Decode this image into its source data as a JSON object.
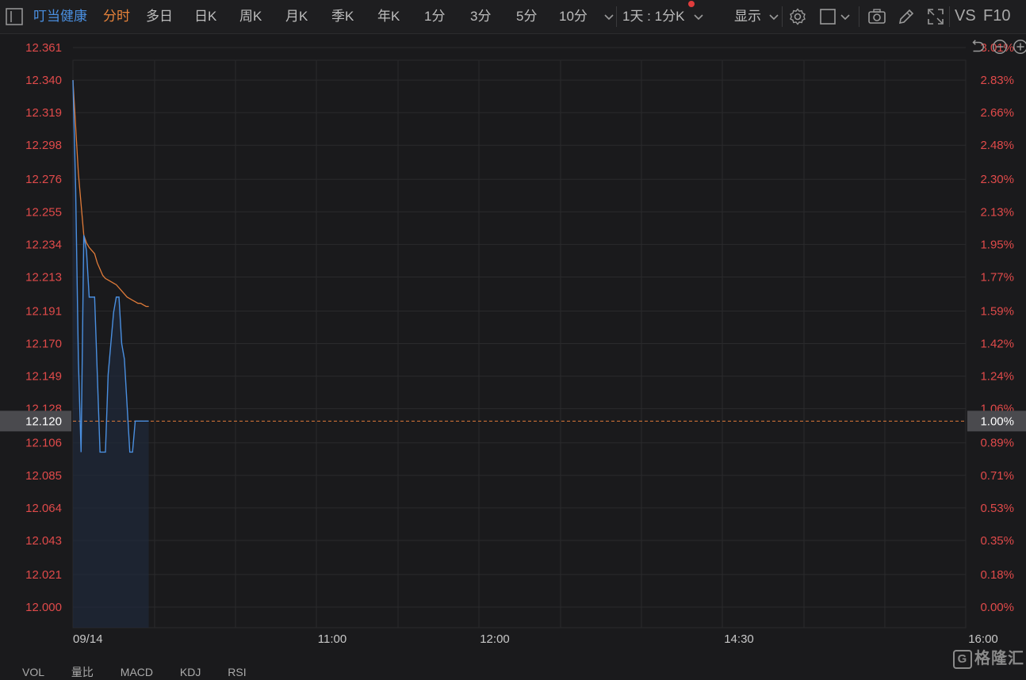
{
  "toolbar": {
    "stock_name": "叮当健康",
    "tabs": [
      "分时",
      "多日",
      "日K",
      "周K",
      "月K",
      "季K",
      "年K",
      "1分",
      "3分",
      "5分",
      "10分"
    ],
    "active_tab": "分时",
    "period_select": "1天 : 1分K",
    "display_label": "显示",
    "vs_label": "VS",
    "f10_label": "F10",
    "icons": [
      "sidebar-toggle-icon",
      "chevron-down-icon",
      "gear-icon",
      "checkbox-icon",
      "camera-icon",
      "pencil-icon",
      "fullscreen-icon",
      "reset-icon",
      "zoom-out-icon",
      "zoom-in-icon"
    ]
  },
  "colors": {
    "background": "#1a1a1c",
    "grid": "#2a2a2c",
    "axis_text": "#e04a4a",
    "price_line": "#4a8fe0",
    "avg_line": "#e07b39",
    "ref_line": "#e07b39",
    "ref_label_bg": "#4a4a4e"
  },
  "chart_data": {
    "type": "line",
    "x_ticks": [
      "09/14",
      "11:00",
      "12:00",
      "14:30",
      "16:00"
    ],
    "y_ticks_left": [
      "12.361",
      "12.340",
      "12.319",
      "12.298",
      "12.276",
      "12.255",
      "12.234",
      "12.213",
      "12.191",
      "12.170",
      "12.149",
      "12.128",
      "12.106",
      "12.085",
      "12.064",
      "12.043",
      "12.021",
      "12.000"
    ],
    "y_ticks_right": [
      "3.01%",
      "2.83%",
      "2.66%",
      "2.48%",
      "2.30%",
      "2.13%",
      "1.95%",
      "1.77%",
      "1.59%",
      "1.42%",
      "1.24%",
      "1.06%",
      "0.89%",
      "0.71%",
      "0.53%",
      "0.35%",
      "0.18%",
      "0.00%"
    ],
    "ylim": [
      12.0,
      12.361
    ],
    "reference_price": 12.12,
    "reference_price_label": "12.120",
    "reference_pct_label": "1.00%",
    "session_minutes": 330,
    "series": [
      {
        "type": "price",
        "x": [
          0,
          1,
          2,
          3,
          4,
          5,
          6,
          7,
          8,
          9,
          10,
          11,
          12,
          13,
          14,
          15,
          16,
          17,
          18,
          19,
          20,
          21,
          22,
          23,
          24,
          25,
          26,
          27,
          28
        ],
        "y": [
          12.34,
          12.27,
          12.16,
          12.1,
          12.24,
          12.23,
          12.2,
          12.2,
          12.2,
          12.15,
          12.1,
          12.1,
          12.1,
          12.15,
          12.17,
          12.19,
          12.2,
          12.2,
          12.17,
          12.16,
          12.13,
          12.1,
          12.1,
          12.12,
          12.12,
          12.12,
          12.12,
          12.12,
          12.12
        ]
      },
      {
        "type": "average",
        "x": [
          0,
          1,
          2,
          3,
          4,
          5,
          6,
          7,
          8,
          9,
          10,
          11,
          12,
          13,
          14,
          15,
          16,
          17,
          18,
          19,
          20,
          21,
          22,
          23,
          24,
          25,
          26,
          27,
          28
        ],
        "y": [
          12.34,
          12.31,
          12.28,
          12.26,
          12.24,
          12.235,
          12.232,
          12.23,
          12.228,
          12.222,
          12.218,
          12.214,
          12.212,
          12.211,
          12.21,
          12.209,
          12.208,
          12.206,
          12.204,
          12.202,
          12.2,
          12.199,
          12.198,
          12.197,
          12.196,
          12.196,
          12.195,
          12.194,
          12.194
        ]
      }
    ]
  },
  "bottom_tabs": [
    "VOL",
    "量比",
    "MACD",
    "KDJ",
    "RSI"
  ],
  "watermark": "格隆汇"
}
